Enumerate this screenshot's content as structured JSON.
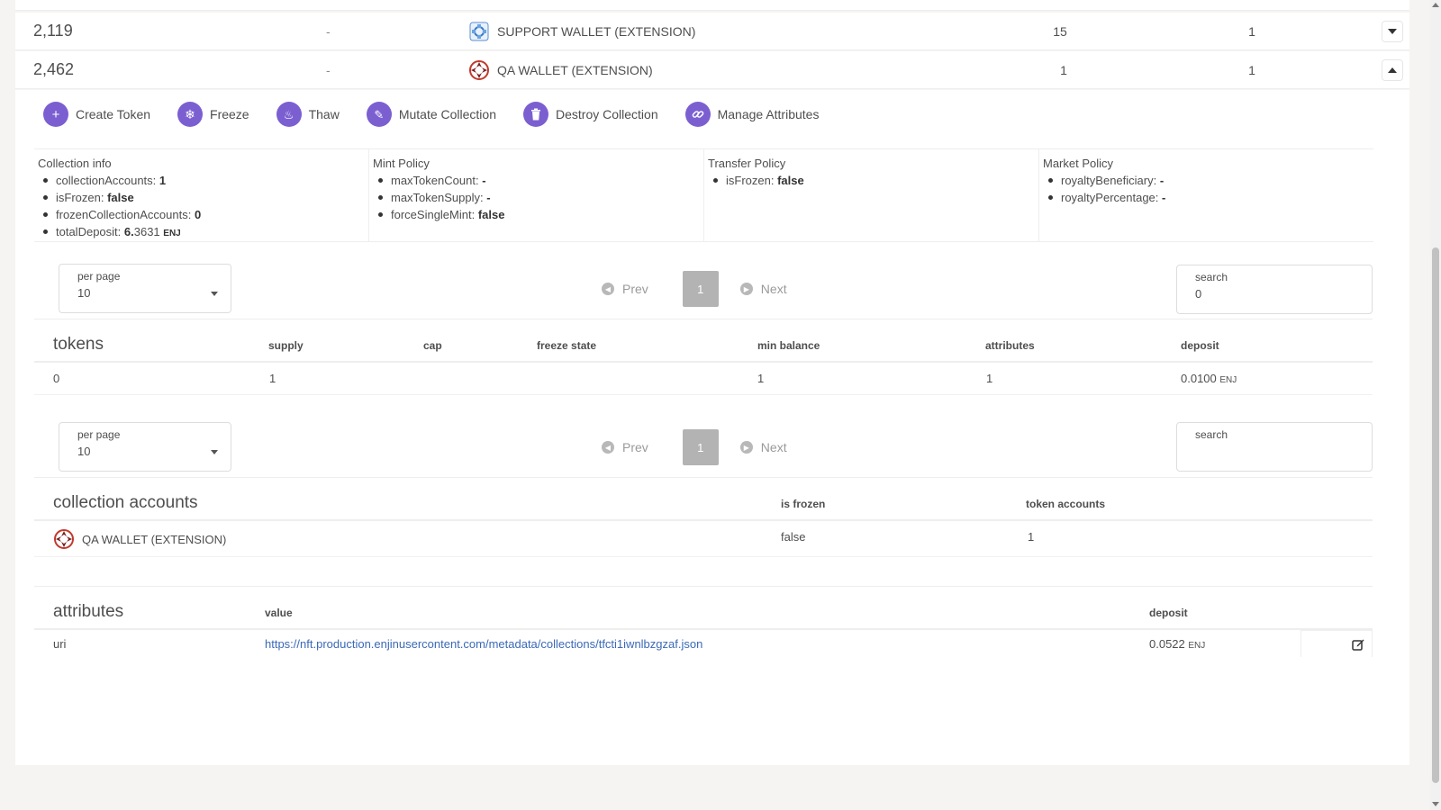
{
  "collections": [
    {
      "id": "2,119",
      "dash": "-",
      "owner": "SUPPORT WALLET (EXTENSION)",
      "col_a": "15",
      "col_b": "1",
      "expanded": false
    },
    {
      "id": "2,462",
      "dash": "-",
      "owner": "QA WALLET (EXTENSION)",
      "col_a": "1",
      "col_b": "1",
      "expanded": true
    }
  ],
  "actions": [
    {
      "label": "Create Token",
      "icon": "plus-icon",
      "glyph": "+"
    },
    {
      "label": "Freeze",
      "icon": "snowflake-icon",
      "glyph": "❄"
    },
    {
      "label": "Thaw",
      "icon": "flame-icon",
      "glyph": "♨"
    },
    {
      "label": "Mutate Collection",
      "icon": "edit-icon",
      "glyph": "✎"
    },
    {
      "label": "Destroy Collection",
      "icon": "trash-icon",
      "glyph": "🗑"
    },
    {
      "label": "Manage Attributes",
      "icon": "link-icon",
      "glyph": "🔗"
    }
  ],
  "info": {
    "collection": {
      "title": "Collection info",
      "items": [
        {
          "key": "collectionAccounts:",
          "val": "1"
        },
        {
          "key": "isFrozen:",
          "val": "false"
        },
        {
          "key": "frozenCollectionAccounts:",
          "val": "0"
        },
        {
          "key": "totalDeposit:",
          "val_bold": "6.",
          "val": "3631",
          "unit": "ENJ"
        }
      ]
    },
    "mint": {
      "title": "Mint Policy",
      "items": [
        {
          "key": "maxTokenCount:",
          "val": "-"
        },
        {
          "key": "maxTokenSupply:",
          "val": "-"
        },
        {
          "key": "forceSingleMint:",
          "val": "false"
        }
      ]
    },
    "transfer": {
      "title": "Transfer Policy",
      "items": [
        {
          "key": "isFrozen:",
          "val": "false"
        }
      ]
    },
    "market": {
      "title": "Market Policy",
      "items": [
        {
          "key": "royaltyBeneficiary:",
          "val": "-"
        },
        {
          "key": "royaltyPercentage:",
          "val": "-"
        }
      ]
    }
  },
  "tokens_controls": {
    "per_page_label": "per page",
    "per_page_value": "10",
    "prev": "Prev",
    "page": "1",
    "next": "Next",
    "search_label": "search",
    "search_value": "0"
  },
  "tokens_table": {
    "title": "tokens",
    "headers": [
      "supply",
      "cap",
      "freeze state",
      "min balance",
      "attributes",
      "deposit"
    ],
    "row": {
      "token": "0",
      "supply": "1",
      "cap": "",
      "freeze_state": "",
      "min_balance": "1",
      "attributes": "1",
      "deposit": "0.0100",
      "deposit_unit": "ENJ"
    }
  },
  "accounts_controls": {
    "per_page_label": "per page",
    "per_page_value": "10",
    "prev": "Prev",
    "page": "1",
    "next": "Next",
    "search_label": "search",
    "search_value": ""
  },
  "accounts_table": {
    "title": "collection accounts",
    "headers": [
      "is frozen",
      "token accounts"
    ],
    "row": {
      "account": "QA WALLET (EXTENSION)",
      "is_frozen": "false",
      "token_accounts": "1"
    }
  },
  "attributes_table": {
    "title": "attributes",
    "headers": [
      "value",
      "deposit"
    ],
    "row": {
      "key": "uri",
      "value": "https://nft.production.enjinusercontent.com/metadata/collections/tfcti1iwnlbzgzaf.json",
      "deposit": "0.0522",
      "deposit_unit": "ENJ"
    }
  },
  "colors": {
    "accent": "#7b5fd1",
    "link": "#3b6ab8"
  }
}
